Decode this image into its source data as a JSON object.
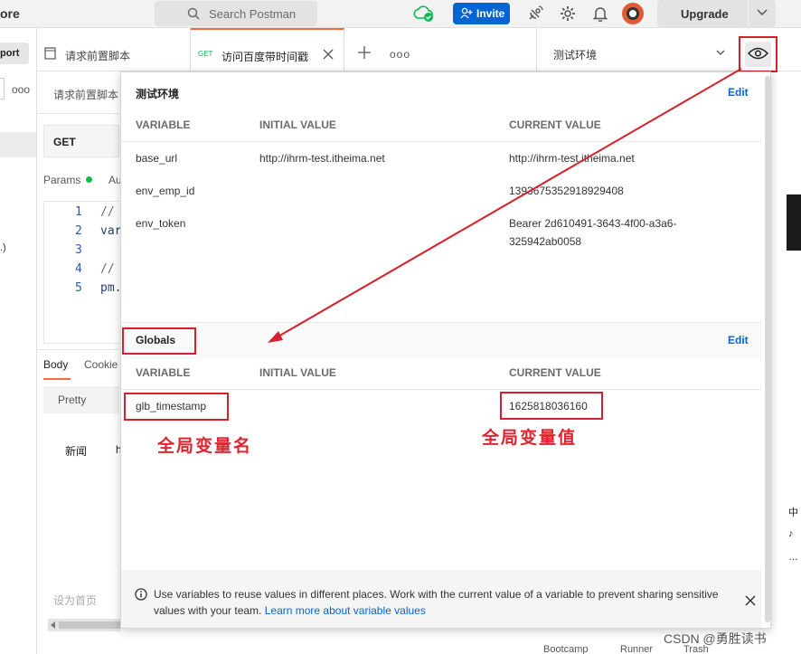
{
  "header": {
    "brand": "ore",
    "search_placeholder": "Search Postman",
    "invite_label": "Invite",
    "upgrade_label": "Upgrade"
  },
  "sidebar": {
    "import_label": "port",
    "more_label": "ooo",
    "partial_text": ".)"
  },
  "tabs": [
    {
      "label": "请求前置脚本"
    },
    {
      "method": "GET",
      "label": "访问百度带时间戳"
    }
  ],
  "tab_more": "ooo",
  "environment": {
    "selected": "测试环境"
  },
  "request": {
    "name": "请求前置脚本",
    "method": "GET",
    "tab_params": "Params",
    "tab_auth": "Au",
    "code_lines": [
      {
        "num": "1",
        "text": "//"
      },
      {
        "num": "2",
        "text": "var"
      },
      {
        "num": "3",
        "text": ""
      },
      {
        "num": "4",
        "text": "//"
      },
      {
        "num": "5",
        "text": "pm."
      }
    ],
    "response_tab_body": "Body",
    "response_tab_cookies": "Cookie",
    "pretty_label": "Pretty",
    "response_text_1": "新闻",
    "response_text_2": "h",
    "homepage_text": "设为首页"
  },
  "popover": {
    "env_section": {
      "title": "测试环境",
      "edit": "Edit",
      "columns": [
        "VARIABLE",
        "INITIAL VALUE",
        "CURRENT VALUE"
      ],
      "rows": [
        {
          "variable": "base_url",
          "initial": "http://ihrm-test.itheima.net",
          "current": "http://ihrm-test.itheima.net"
        },
        {
          "variable": "env_emp_id",
          "initial": "",
          "current": "1393675352918929408"
        },
        {
          "variable": "env_token",
          "initial": "",
          "current": "Bearer 2d610491-3643-4f00-a3a6-",
          "current_line2": "325942ab0058"
        }
      ]
    },
    "globals_section": {
      "title": "Globals",
      "edit": "Edit",
      "columns": [
        "VARIABLE",
        "INITIAL VALUE",
        "CURRENT VALUE"
      ],
      "rows": [
        {
          "variable": "glb_timestamp",
          "initial": "",
          "current": "1625818036160"
        }
      ]
    },
    "info": {
      "text": "Use variables to reuse values in different places. Work with the current value of a variable to prevent sharing sensitive values with your team.",
      "link": "Learn more about variable values"
    }
  },
  "annotations": {
    "global_var_name": "全局变量名",
    "global_var_value": "全局变量值"
  },
  "footer": {
    "bootcamp": "Bootcamp",
    "runner": "Runner",
    "trash": "Trash"
  },
  "watermark": "CSDN @勇胜读书",
  "right_edge": {
    "char1": "中",
    "char2": "♪",
    "char3": "…"
  },
  "colors": {
    "accent": "#f26b3a",
    "invite": "#0265d2",
    "link": "#0265d2",
    "annotation_red": "#d6202b",
    "get_method": "#0cbb52"
  }
}
